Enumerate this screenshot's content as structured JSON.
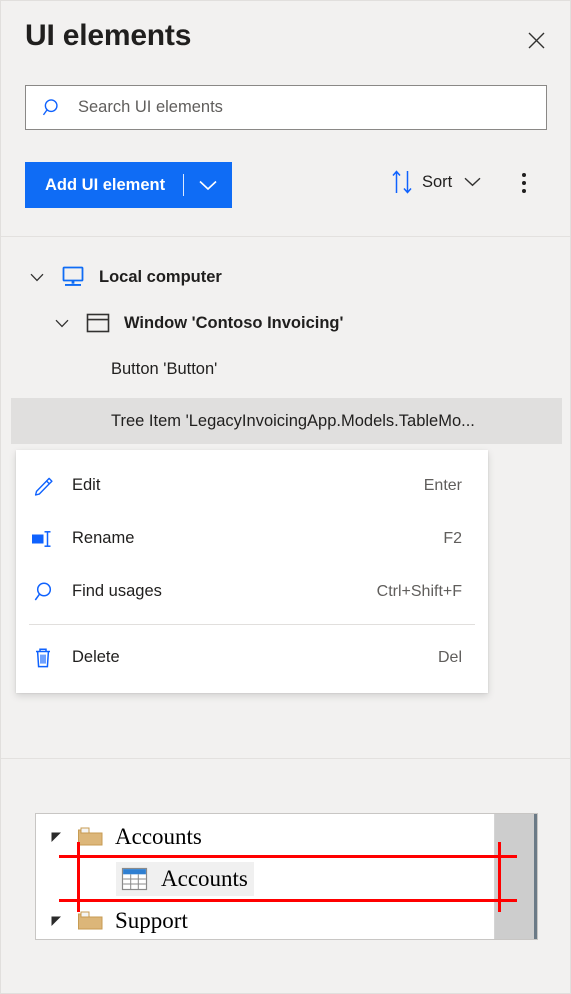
{
  "header": {
    "title": "UI elements",
    "close_icon": "close-icon"
  },
  "search": {
    "placeholder": "Search UI elements",
    "value": "",
    "icon": "search-icon"
  },
  "toolbar": {
    "add_label": "Add UI element",
    "add_caret_icon": "chevron-down-icon",
    "sort_label": "Sort",
    "sort_icon": "sort-arrows-icon",
    "sort_caret_icon": "chevron-down-icon",
    "more_icon": "more-vertical-icon",
    "accent_color": "#0f6cf5"
  },
  "tree": {
    "rows": [
      {
        "label": "Local computer",
        "icon": "monitor-icon",
        "chevron": "chevron-down-icon",
        "selected": false
      },
      {
        "label": "Window 'Contoso Invoicing'",
        "icon": "window-icon",
        "chevron": "chevron-down-icon",
        "selected": false
      },
      {
        "label": "Button 'Button'",
        "icon": "",
        "chevron": "",
        "selected": false
      },
      {
        "label": "Tree Item 'LegacyInvoicingApp.Models.TableMo...",
        "icon": "",
        "chevron": "",
        "selected": true
      }
    ],
    "selected_bg": "#e0dfde"
  },
  "context_menu": {
    "items": [
      {
        "label": "Edit",
        "shortcut": "Enter",
        "icon": "pencil-icon"
      },
      {
        "label": "Rename",
        "shortcut": "F2",
        "icon": "rename-icon"
      },
      {
        "label": "Find usages",
        "shortcut": "Ctrl+Shift+F",
        "icon": "search-icon"
      },
      {
        "label": "Delete",
        "shortcut": "Del",
        "icon": "trash-icon"
      }
    ],
    "separator_before_index": 3,
    "icon_color": "#0f62fe"
  },
  "preview": {
    "rows": [
      {
        "label": "Accounts",
        "icon": "folder-icon",
        "expander": "collapse-triangle-icon",
        "selected": false
      },
      {
        "label": "Accounts",
        "icon": "table-grid-icon",
        "expander": "",
        "selected": true
      },
      {
        "label": "Support",
        "icon": "folder-icon",
        "expander": "collapse-triangle-icon",
        "selected": false
      }
    ],
    "highlight_color": "#ff0000",
    "scrollbar": "vertical-scrollbar"
  }
}
